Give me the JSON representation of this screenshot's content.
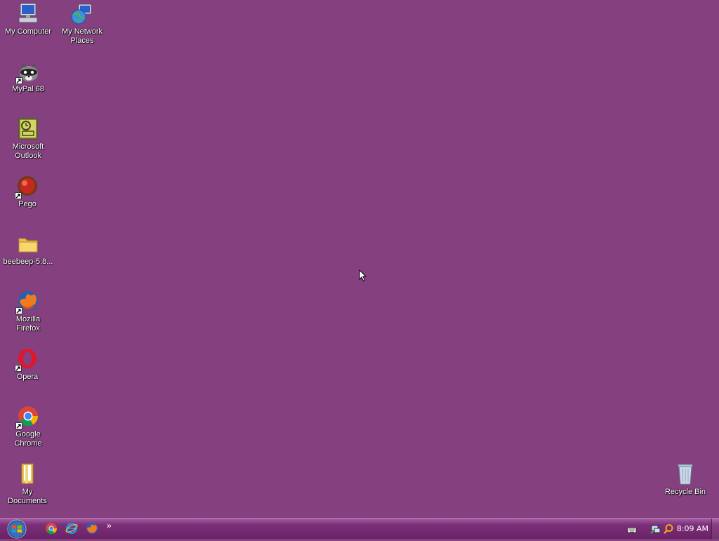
{
  "desktop": {
    "background": "#84407f",
    "icons": {
      "my_computer": "My Computer",
      "my_network_places": "My Network\nPlaces",
      "mypal": "MyPal 68",
      "outlook": "Microsoft\nOutlook",
      "pego": "Pego",
      "beebeep": "beebeep-5.8...",
      "firefox": "Mozilla\nFirefox",
      "opera": "Opera",
      "chrome": "Google\nChrome",
      "my_documents": "My\nDocuments",
      "recycle_bin": "Recycle Bin"
    }
  },
  "taskbar": {
    "chevron": "»",
    "clock": "8:09 AM",
    "color": "#7c2f79"
  }
}
